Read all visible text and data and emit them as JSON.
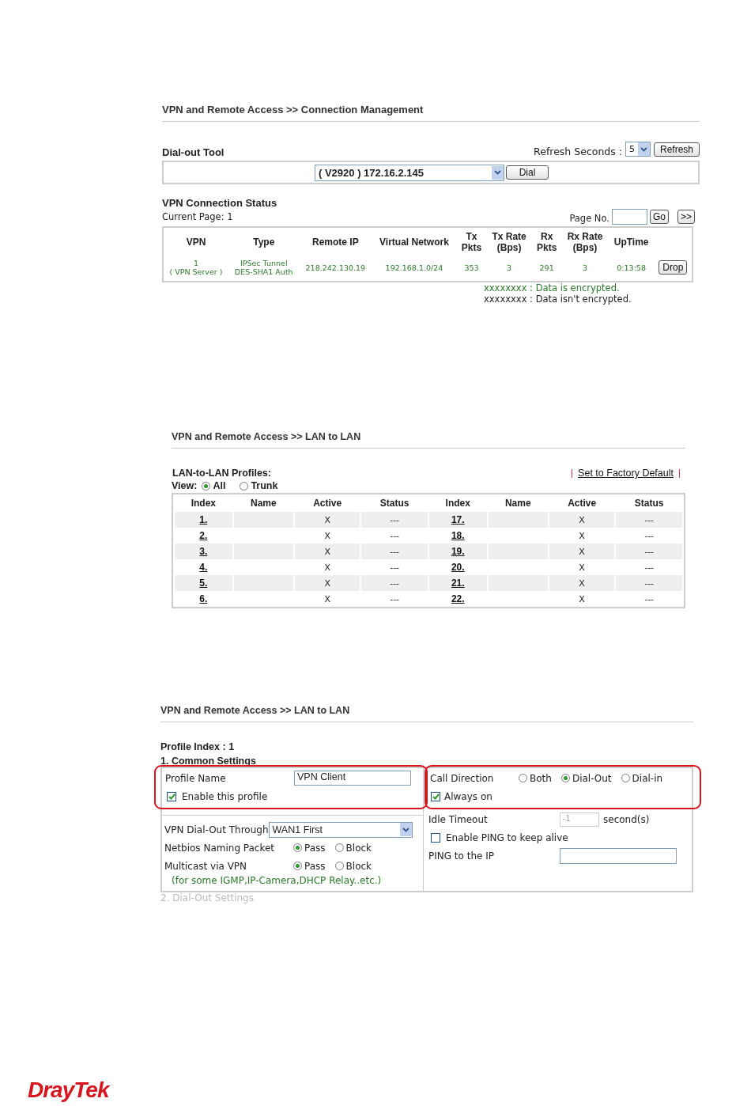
{
  "connection_management": {
    "title": "VPN and Remote Access >> Connection Management",
    "dial_out_tool": {
      "label": "Dial-out Tool",
      "refresh_label": "Refresh Seconds :",
      "refresh_value": "5",
      "refresh_button": "Refresh",
      "host": "( V2920 ) 172.16.2.145",
      "dial_button": "Dial"
    },
    "status": {
      "title": "VPN Connection Status",
      "current_page": "Current Page: 1",
      "page_no_label": "Page No.",
      "go_button": "Go",
      "next_button": ">>",
      "columns": [
        "VPN",
        "Type",
        "Remote IP",
        "Virtual Network",
        "Tx\nPkts",
        "Tx Rate\n(Bps)",
        "Rx\nPkts",
        "Rx Rate\n(Bps)",
        "UpTime"
      ],
      "rows": [
        {
          "cells": [
            "1\n( VPN Server )",
            "IPSec Tunnel\nDES-SHA1 Auth",
            "218.242.130.19",
            "192.168.1.0/24",
            "353",
            "3",
            "291",
            "3",
            "0:13:58"
          ],
          "encrypted": true,
          "action": "Drop"
        }
      ],
      "legend": [
        {
          "sample": "xxxxxxxx",
          "text": ": Data is encrypted.",
          "encrypted": true
        },
        {
          "sample": "xxxxxxxx",
          "text": ": Data isn't encrypted.",
          "encrypted": false
        }
      ]
    }
  },
  "lan_to_lan": {
    "title": "VPN and Remote Access >> LAN to LAN",
    "profiles_label": "LAN-to-LAN Profiles:",
    "factory_link": "Set to Factory Default",
    "view_label": "View:",
    "view_options": [
      {
        "label": "All",
        "selected": true
      },
      {
        "label": "Trunk",
        "selected": false
      }
    ],
    "columns": [
      "Index",
      "Name",
      "Active",
      "Status",
      "Index",
      "Name",
      "Active",
      "Status"
    ],
    "rows": [
      {
        "left": {
          "index": "1.",
          "active": "X",
          "status": "---"
        },
        "right": {
          "index": "17.",
          "active": "X",
          "status": "---"
        }
      },
      {
        "left": {
          "index": "2.",
          "active": "X",
          "status": "---"
        },
        "right": {
          "index": "18.",
          "active": "X",
          "status": "---"
        }
      },
      {
        "left": {
          "index": "3.",
          "active": "X",
          "status": "---"
        },
        "right": {
          "index": "19.",
          "active": "X",
          "status": "---"
        }
      },
      {
        "left": {
          "index": "4.",
          "active": "X",
          "status": "---"
        },
        "right": {
          "index": "20.",
          "active": "X",
          "status": "---"
        }
      },
      {
        "left": {
          "index": "5.",
          "active": "X",
          "status": "---"
        },
        "right": {
          "index": "21.",
          "active": "X",
          "status": "---"
        }
      },
      {
        "left": {
          "index": "6.",
          "active": "X",
          "status": "---"
        },
        "right": {
          "index": "22.",
          "active": "X",
          "status": "---"
        }
      }
    ]
  },
  "profile_edit": {
    "title": "VPN and Remote Access >> LAN to LAN",
    "profile_index": "Profile Index : 1",
    "section": "1. Common Settings",
    "profile_name": {
      "label": "Profile Name",
      "value": "VPN Client"
    },
    "enable": {
      "label": "Enable this profile",
      "checked": true
    },
    "dial_out_through": {
      "label": "VPN Dial-Out Through",
      "value": "WAN1 First"
    },
    "netbios": {
      "label": "Netbios Naming Packet",
      "options": [
        {
          "label": "Pass",
          "selected": true
        },
        {
          "label": "Block",
          "selected": false
        }
      ]
    },
    "multicast": {
      "label": "Multicast via VPN",
      "options": [
        {
          "label": "Pass",
          "selected": true
        },
        {
          "label": "Block",
          "selected": false
        }
      ]
    },
    "note": "(for some IGMP,IP-Camera,DHCP Relay..etc.)",
    "call_direction": {
      "label": "Call Direction",
      "options": [
        {
          "label": "Both",
          "selected": false
        },
        {
          "label": "Dial-Out",
          "selected": true
        },
        {
          "label": "Dial-in",
          "selected": false
        }
      ]
    },
    "always_on": {
      "label": "Always on",
      "checked": true
    },
    "idle_timeout": {
      "label": "Idle Timeout",
      "value": "-1",
      "unit": "second(s)",
      "disabled": true
    },
    "ping_keep_alive": {
      "label": "Enable PING to keep alive",
      "checked": false
    },
    "ping_ip": {
      "label": "PING to the IP"
    },
    "next_section": "2. Dial-Out Settings"
  },
  "footer": {
    "logo": "DrayTek"
  }
}
